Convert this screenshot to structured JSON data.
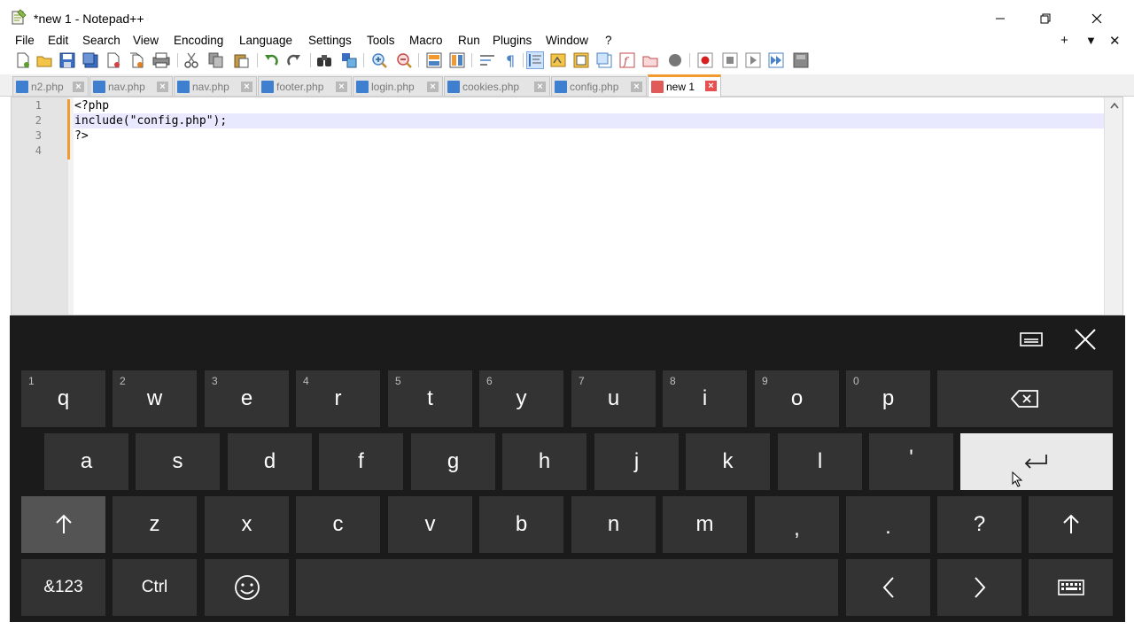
{
  "window": {
    "title": "*new 1 - Notepad++"
  },
  "menu": {
    "items": [
      "File",
      "Edit",
      "Search",
      "View",
      "Encoding",
      "Language",
      "Settings",
      "Tools",
      "Macro",
      "Run",
      "Plugins",
      "Window",
      "?"
    ],
    "right_controls": [
      "+",
      "▼",
      "✕"
    ]
  },
  "tabs": [
    {
      "label": "n2.php",
      "active": false
    },
    {
      "label": "nav.php",
      "active": false
    },
    {
      "label": "nav.php",
      "active": false
    },
    {
      "label": "footer.php",
      "active": false
    },
    {
      "label": "login.php",
      "active": false
    },
    {
      "label": "cookies.php",
      "active": false
    },
    {
      "label": "config.php",
      "active": false
    },
    {
      "label": "new 1",
      "active": true
    }
  ],
  "editor": {
    "lines": [
      {
        "number": "1",
        "text": "<?php"
      },
      {
        "number": "2",
        "text": "include(\"config.php\");"
      },
      {
        "number": "3",
        "text": "?>"
      },
      {
        "number": "4",
        "text": ""
      }
    ],
    "current_line": 2
  },
  "keyboard": {
    "row1": [
      {
        "label": "q",
        "num": "1"
      },
      {
        "label": "w",
        "num": "2"
      },
      {
        "label": "e",
        "num": "3"
      },
      {
        "label": "r",
        "num": "4"
      },
      {
        "label": "t",
        "num": "5"
      },
      {
        "label": "y",
        "num": "6"
      },
      {
        "label": "u",
        "num": "7"
      },
      {
        "label": "i",
        "num": "8"
      },
      {
        "label": "o",
        "num": "9"
      },
      {
        "label": "p",
        "num": "0"
      }
    ],
    "row2": [
      "a",
      "s",
      "d",
      "f",
      "g",
      "h",
      "j",
      "k",
      "l",
      "'"
    ],
    "row3": [
      "z",
      "x",
      "c",
      "v",
      "b",
      "n",
      "m",
      ",",
      ".",
      "?"
    ],
    "symbols_label": "&123",
    "ctrl_label": "Ctrl",
    "icons": {
      "backspace": "backspace-icon",
      "enter": "enter-icon",
      "shift": "shift-icon",
      "emoji": "emoji-icon",
      "left": "arrow-left-icon",
      "right": "arrow-right-icon",
      "keyboard": "keyboard-icon",
      "dock": "dock-icon",
      "close": "close-icon"
    }
  },
  "colors": {
    "tab_active_accent": "#f29a30",
    "change_bar": "#f29a30",
    "current_line": "#e8e8ff",
    "keyboard_bg": "#1b1b1b",
    "key_bg": "#333333",
    "enter_key_bg": "#e9e9e9"
  }
}
